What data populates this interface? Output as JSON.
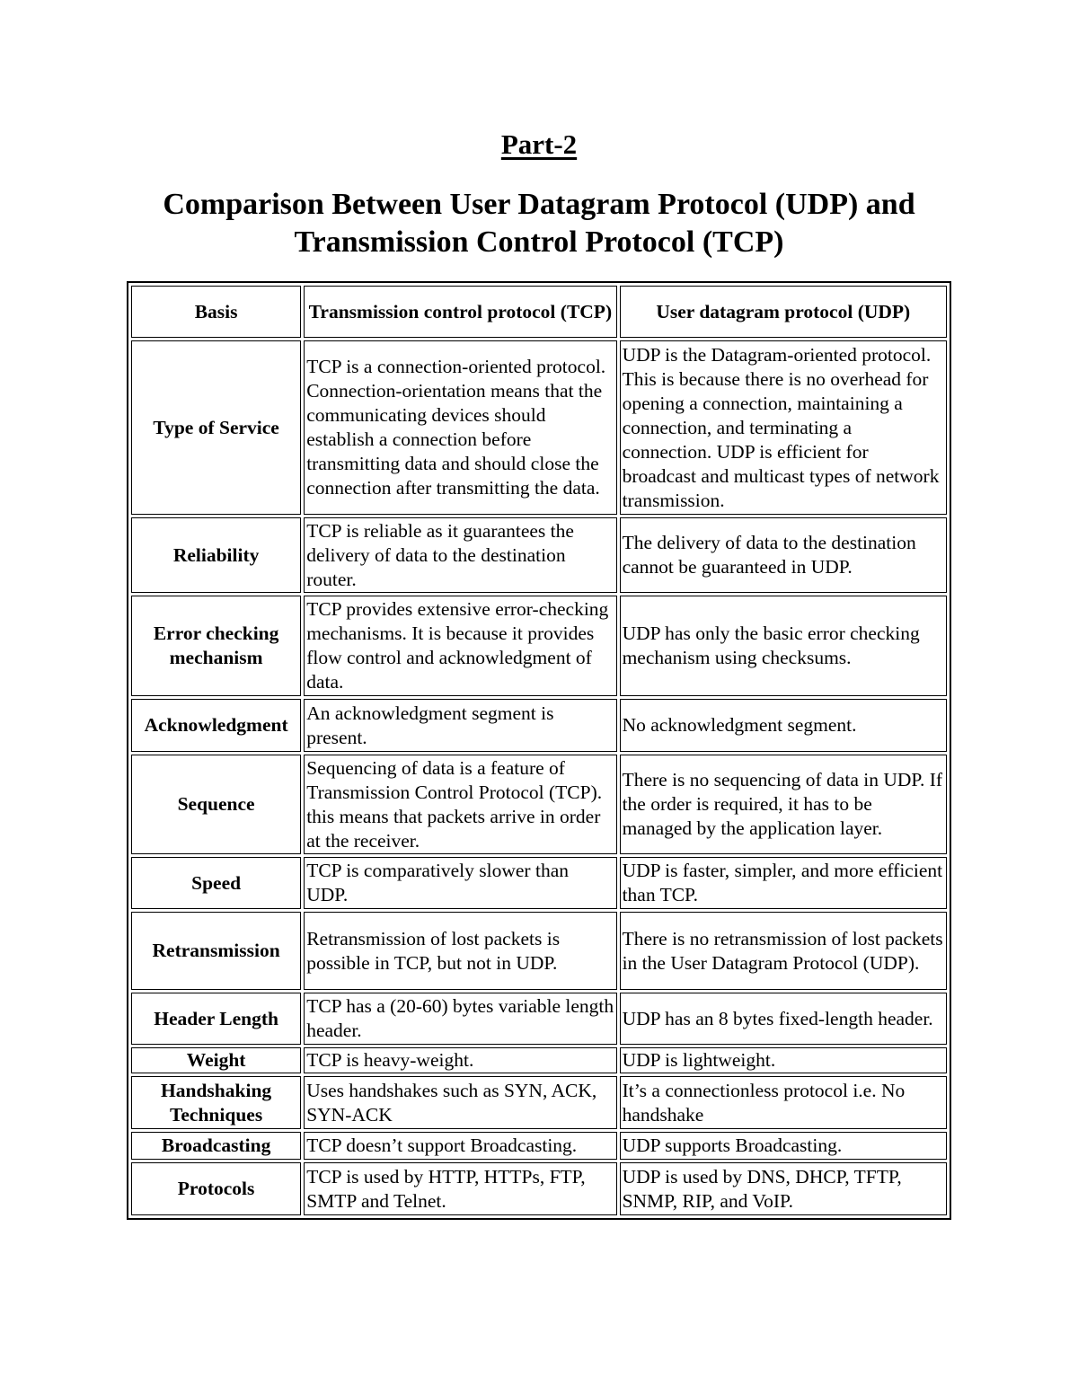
{
  "document": {
    "part_heading": "Part-2",
    "title_line1": "Comparison Between User Datagram Protocol (UDP) and",
    "title_line2": "Transmission Control Protocol (TCP)"
  },
  "table": {
    "headers": {
      "basis": "Basis",
      "tcp": "Transmission control protocol (TCP)",
      "udp": "User datagram protocol (UDP)"
    },
    "rows": [
      {
        "basis": "Type of Service",
        "tcp": "TCP is a connection-oriented protocol. Connection-orientation means that the communicating devices should establish a connection before transmitting data and should close the connection after transmitting the data.",
        "udp": "UDP is the Datagram-oriented protocol. This is because there is no overhead for opening a connection, maintaining a connection, and terminating a connection. UDP is efficient for broadcast and multicast types of network transmission."
      },
      {
        "basis": "Reliability",
        "tcp": "TCP is reliable as it guarantees the delivery of data to the destination router.",
        "udp": "The delivery of data to the destination cannot be guaranteed in UDP."
      },
      {
        "basis": "Error checking mechanism",
        "tcp": "TCP provides extensive error-checking mechanisms. It is because it provides flow control and acknowledgment of data.",
        "udp": "UDP has only the basic error checking mechanism using checksums."
      },
      {
        "basis": "Acknowledgment",
        "tcp": "An acknowledgment segment is present.",
        "udp": "No acknowledgment segment."
      },
      {
        "basis": "Sequence",
        "tcp": "Sequencing of data is a feature of Transmission Control Protocol (TCP). this means that packets arrive in order at the receiver.",
        "udp": "There is no sequencing of data in UDP. If the order is required, it has to be managed by the application layer."
      },
      {
        "basis": "Speed",
        "tcp": "TCP is comparatively slower than UDP.",
        "udp": "UDP is faster, simpler, and more efficient than TCP."
      },
      {
        "basis": "Retransmission",
        "tcp": "Retransmission of lost packets is possible in TCP, but not in UDP.",
        "udp": "There is no retransmission of lost packets in the User Datagram Protocol (UDP)."
      },
      {
        "basis": "Header Length",
        "tcp": "TCP has a (20-60) bytes variable length header.",
        "udp": "UDP has an 8 bytes fixed-length header."
      },
      {
        "basis": "Weight",
        "tcp": "TCP is heavy-weight.",
        "udp": "UDP is lightweight."
      },
      {
        "basis": "Handshaking Techniques",
        "tcp": "Uses handshakes such as SYN, ACK, SYN-ACK",
        "udp": "It’s a connectionless protocol i.e. No handshake"
      },
      {
        "basis": "Broadcasting",
        "tcp": "TCP doesn’t support Broadcasting.",
        "udp": "UDP supports Broadcasting."
      },
      {
        "basis": "Protocols",
        "tcp": "TCP is used by HTTP, HTTPs, FTP, SMTP and Telnet.",
        "udp": "UDP is used by DNS, DHCP, TFTP, SNMP, RIP, and VoIP."
      }
    ]
  }
}
